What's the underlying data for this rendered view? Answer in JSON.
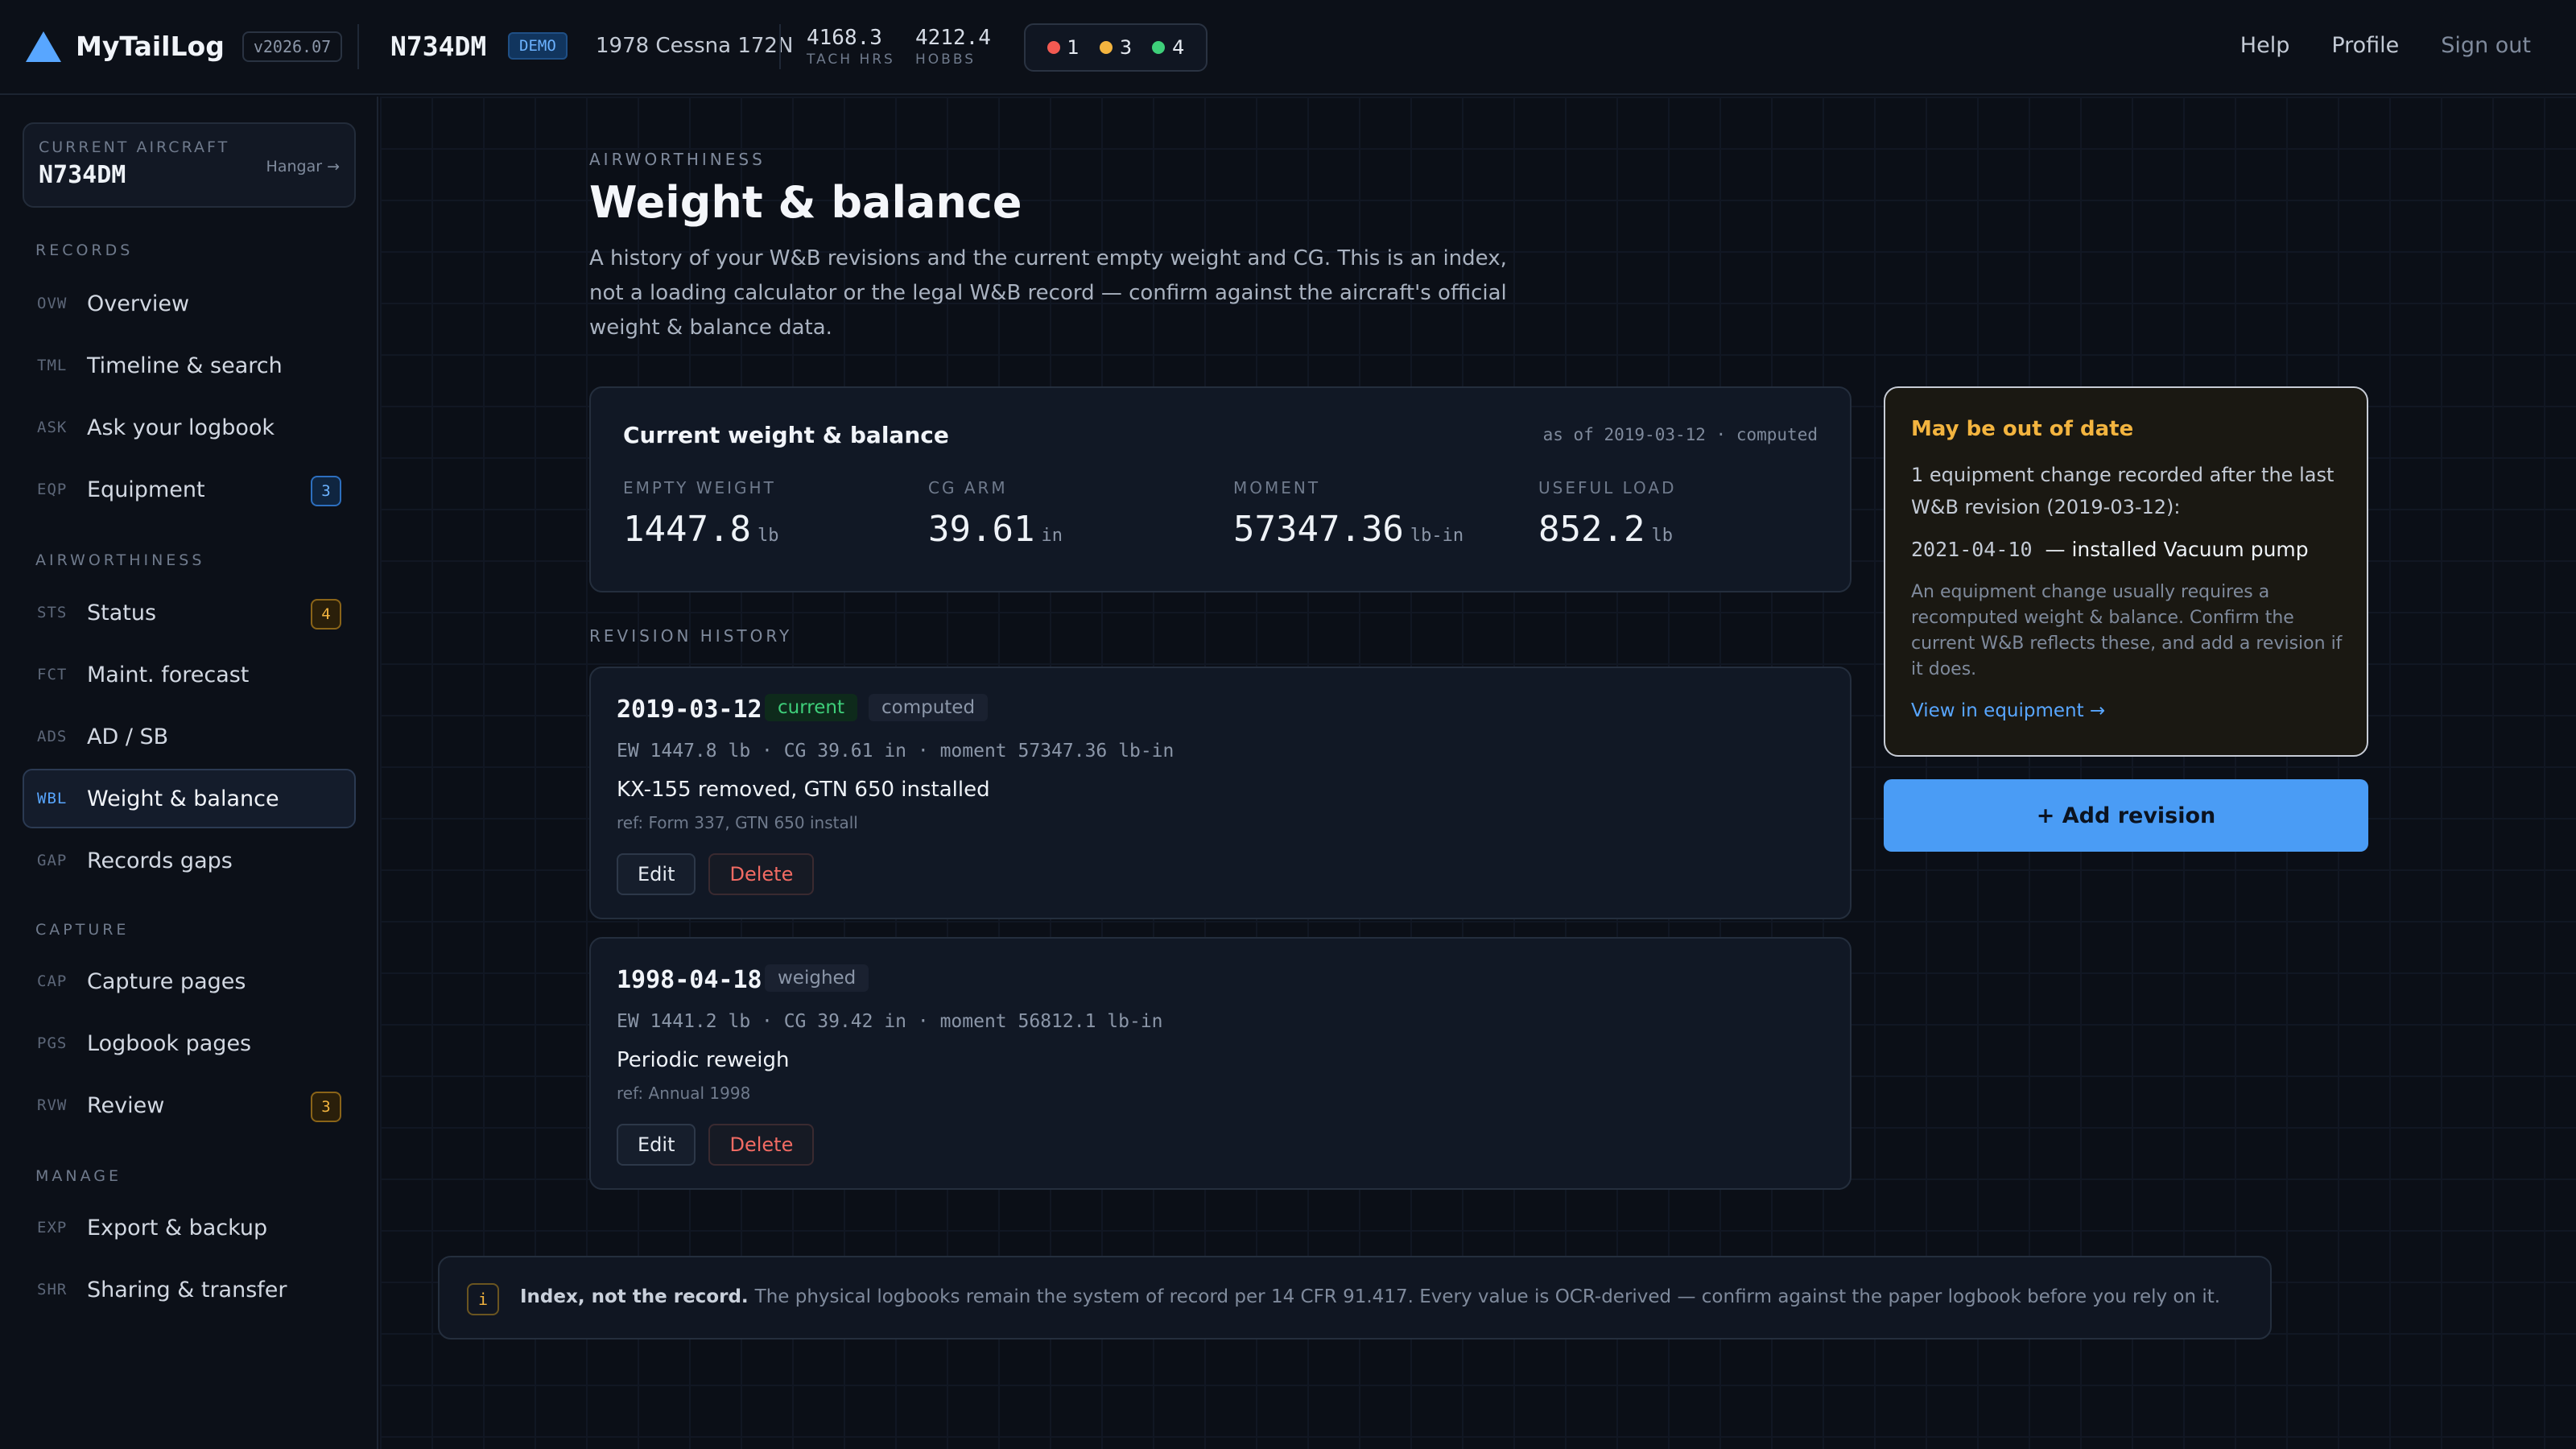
{
  "topbar": {
    "brand": "MyTailLog",
    "version": "v2026.07",
    "tail": "N734DM",
    "demo": "DEMO",
    "model": "1978 Cessna 172N",
    "tach_value": "4168.3",
    "tach_label": "TACH HRS",
    "hobbs_value": "4212.4",
    "hobbs_label": "HOBBS",
    "status": {
      "red": "1",
      "amber": "3",
      "green": "4"
    },
    "links": {
      "help": "Help",
      "profile": "Profile",
      "signout": "Sign out"
    }
  },
  "sidebar": {
    "current_label": "CURRENT AIRCRAFT",
    "current_tail": "N734DM",
    "hangar": "Hangar →",
    "sections": {
      "records": "RECORDS",
      "airworthiness": "AIRWORTHINESS",
      "capture": "CAPTURE",
      "manage": "MANAGE"
    },
    "items": [
      {
        "code": "OVW",
        "label": "Overview"
      },
      {
        "code": "TML",
        "label": "Timeline & search"
      },
      {
        "code": "ASK",
        "label": "Ask your logbook"
      },
      {
        "code": "EQP",
        "label": "Equipment",
        "badge": "3"
      },
      {
        "code": "STS",
        "label": "Status",
        "badge": "4"
      },
      {
        "code": "FCT",
        "label": "Maint. forecast"
      },
      {
        "code": "ADS",
        "label": "AD / SB"
      },
      {
        "code": "WBL",
        "label": "Weight & balance"
      },
      {
        "code": "GAP",
        "label": "Records gaps"
      },
      {
        "code": "CAP",
        "label": "Capture pages"
      },
      {
        "code": "PGS",
        "label": "Logbook pages"
      },
      {
        "code": "RVW",
        "label": "Review",
        "badge": "3"
      },
      {
        "code": "EXP",
        "label": "Export & backup"
      },
      {
        "code": "SHR",
        "label": "Sharing & transfer"
      }
    ]
  },
  "main": {
    "eyebrow": "AIRWORTHINESS",
    "title": "Weight & balance",
    "description": "A history of your W&B revisions and the current empty weight and CG. This is an index, not a loading calculator or the legal W&B record — confirm against the aircraft's official weight & balance data.",
    "current": {
      "title": "Current weight & balance",
      "as_of": "as of 2019-03-12 · computed",
      "metrics": [
        {
          "label": "EMPTY WEIGHT",
          "value": "1447.8",
          "unit": "lb"
        },
        {
          "label": "CG ARM",
          "value": "39.61",
          "unit": "in"
        },
        {
          "label": "MOMENT",
          "value": "57347.36",
          "unit": "lb-in"
        },
        {
          "label": "USEFUL LOAD",
          "value": "852.2",
          "unit": "lb"
        }
      ]
    },
    "revision_label": "REVISION HISTORY",
    "revisions": [
      {
        "date": "2019-03-12",
        "tag_current": "current",
        "tag_method": "computed",
        "stats": "EW 1447.8 lb · CG 39.61 in · moment 57347.36 lb-in",
        "desc": "KX-155 removed, GTN 650 installed",
        "ref": "ref: Form 337, GTN 650 install",
        "edit": "Edit",
        "delete": "Delete"
      },
      {
        "date": "1998-04-18",
        "tag_method": "weighed",
        "stats": "EW 1441.2 lb · CG 39.42 in · moment 56812.1 lb-in",
        "desc": "Periodic reweigh",
        "ref": "ref: Annual 1998",
        "edit": "Edit",
        "delete": "Delete"
      }
    ],
    "warning": {
      "title": "May be out of date",
      "body": "1 equipment change recorded after the last W&B revision (2019-03-12):",
      "item_date": "2021-04-10",
      "item_text": "— installed Vacuum pump",
      "note": "An equipment change usually requires a recomputed weight & balance. Confirm the current W&B reflects these, and add a revision if it does.",
      "link": "View in equipment →"
    },
    "add_button": "+ Add revision",
    "notice": {
      "icon": "i",
      "bold": "Index, not the record.",
      "text": "The physical logbooks remain the system of record per 14 CFR 91.417. Every value is OCR-derived — confirm against the paper logbook before you rely on it."
    }
  },
  "colors": {
    "accent": "#58a6ff",
    "warning": "#f3b43f",
    "danger": "#f26b63",
    "success": "#3ecf7a",
    "status_red": "#f25a52",
    "status_amber": "#f3b43f",
    "status_green": "#3ecf7a"
  }
}
